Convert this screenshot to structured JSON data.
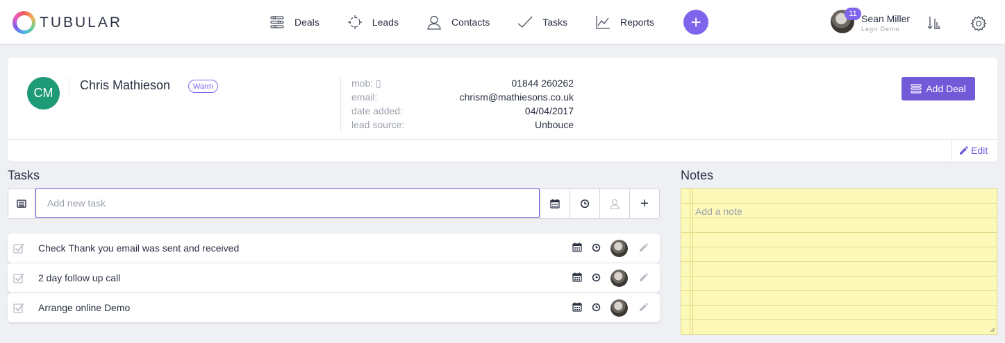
{
  "brand": {
    "name": "TUBULAR"
  },
  "nav": {
    "items": [
      {
        "label": "Deals",
        "icon": "sliders-icon"
      },
      {
        "label": "Leads",
        "icon": "crosshair-icon"
      },
      {
        "label": "Contacts",
        "icon": "person-icon"
      },
      {
        "label": "Tasks",
        "icon": "check-icon"
      },
      {
        "label": "Reports",
        "icon": "line-chart-icon"
      }
    ],
    "add_label": "+"
  },
  "user": {
    "name": "Sean Miller",
    "subtitle": "Lego Demo",
    "notifications": "11"
  },
  "contact": {
    "initials": "CM",
    "avatar_color": "#1e9a77",
    "name": "Chris Mathieson",
    "tag": "Warm",
    "details": [
      {
        "label": "mob: ▯",
        "value": "01844 260262"
      },
      {
        "label": "email:",
        "value": "chrism@mathiesons.co.uk"
      },
      {
        "label": "date added:",
        "value": "04/04/2017"
      },
      {
        "label": "lead source:",
        "value": "Unbouce"
      }
    ],
    "add_deal_label": "Add Deal",
    "edit_label": "Edit"
  },
  "tasks": {
    "title": "Tasks",
    "input_placeholder": "Add new task",
    "add_label": "+",
    "items": [
      {
        "text": "Check Thank you email was sent and received"
      },
      {
        "text": "2 day follow up call"
      },
      {
        "text": "Arrange online Demo"
      }
    ]
  },
  "notes": {
    "title": "Notes",
    "placeholder": "Add a note"
  },
  "colors": {
    "accent": "#7f64ec",
    "button": "#7259d8",
    "notes_bg": "#fdf9b9"
  }
}
